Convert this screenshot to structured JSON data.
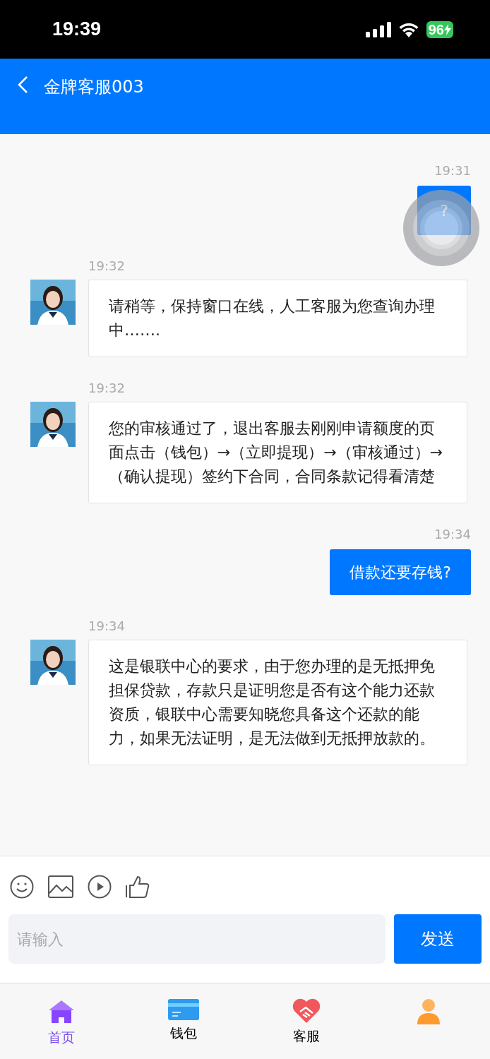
{
  "status_bar": {
    "time": "19:39",
    "battery": "96"
  },
  "header": {
    "title": "金牌客服003"
  },
  "messages": [
    {
      "kind": "user",
      "time": "19:31",
      "text": "?"
    },
    {
      "kind": "agent",
      "time": "19:32",
      "text": "请稍等，保持窗口在线，人工客服为您查询办理中……."
    },
    {
      "kind": "agent",
      "time": "19:32",
      "text": "您的审核通过了，退出客服去刚刚申请额度的页面点击（钱包）→（立即提现）→（审核通过）→（确认提现）签约下合同，合同条款记得看清楚"
    },
    {
      "kind": "user",
      "time": "19:34",
      "text": "借款还要存钱?"
    },
    {
      "kind": "agent",
      "time": "19:34",
      "text": "这是银联中心的要求，由于您办理的是无抵押免担保贷款，存款只是证明您是否有这个能力还款资质，银联中心需要知晓您具备这个还款的能力，如果无法证明，是无法做到无抵押放款的。"
    }
  ],
  "composer": {
    "placeholder": "请输入",
    "send": "发送"
  },
  "tabs": [
    {
      "kind": "home",
      "label": "首页",
      "selected": true
    },
    {
      "kind": "wallet",
      "label": "钱包",
      "selected": false
    },
    {
      "kind": "service",
      "label": "客服",
      "selected": false
    },
    {
      "kind": "profile",
      "selected": false
    }
  ]
}
